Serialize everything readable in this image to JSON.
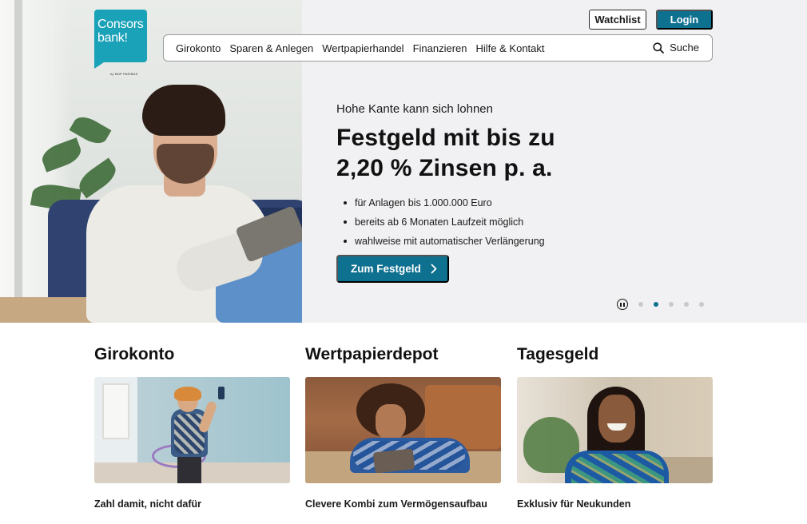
{
  "brand": {
    "logo_line1": "Consors",
    "logo_line2": "bank!",
    "logo_byline": "by BNP PARIBAS",
    "color": "#1aa2b8"
  },
  "header": {
    "watchlist_label": "Watchlist",
    "login_label": "Login",
    "accent_color": "#0f7190"
  },
  "nav": {
    "items": [
      {
        "label": "Girokonto"
      },
      {
        "label": "Sparen & Anlegen"
      },
      {
        "label": "Wertpapierhandel"
      },
      {
        "label": "Finanzieren"
      },
      {
        "label": "Hilfe & Kontakt"
      }
    ],
    "search_label": "Suche",
    "search_icon": "search-icon"
  },
  "hero": {
    "kicker": "Hohe Kante kann sich lohnen",
    "title_line1": "Festgeld mit bis zu",
    "title_line2": "2,20 % Zinsen p. a.",
    "bullets": [
      {
        "text": "für Anlagen bis 1.000.000 Euro"
      },
      {
        "text": "bereits ab 6 Monaten Laufzeit möglich"
      },
      {
        "text": "wahlweise mit automatischer Verlängerung"
      }
    ],
    "cta_label": "Zum Festgeld",
    "cta_icon": "chevron-right-icon",
    "carousel": {
      "slide_count": 5,
      "active_index": 1,
      "pause_icon": "pause-icon"
    }
  },
  "products": [
    {
      "title": "Girokonto",
      "caption": "Zahl damit, nicht dafür"
    },
    {
      "title": "Wertpapierdepot",
      "caption": "Clevere Kombi zum Vermögensaufbau"
    },
    {
      "title": "Tagesgeld",
      "caption": "Exklusiv für Neukunden"
    }
  ]
}
